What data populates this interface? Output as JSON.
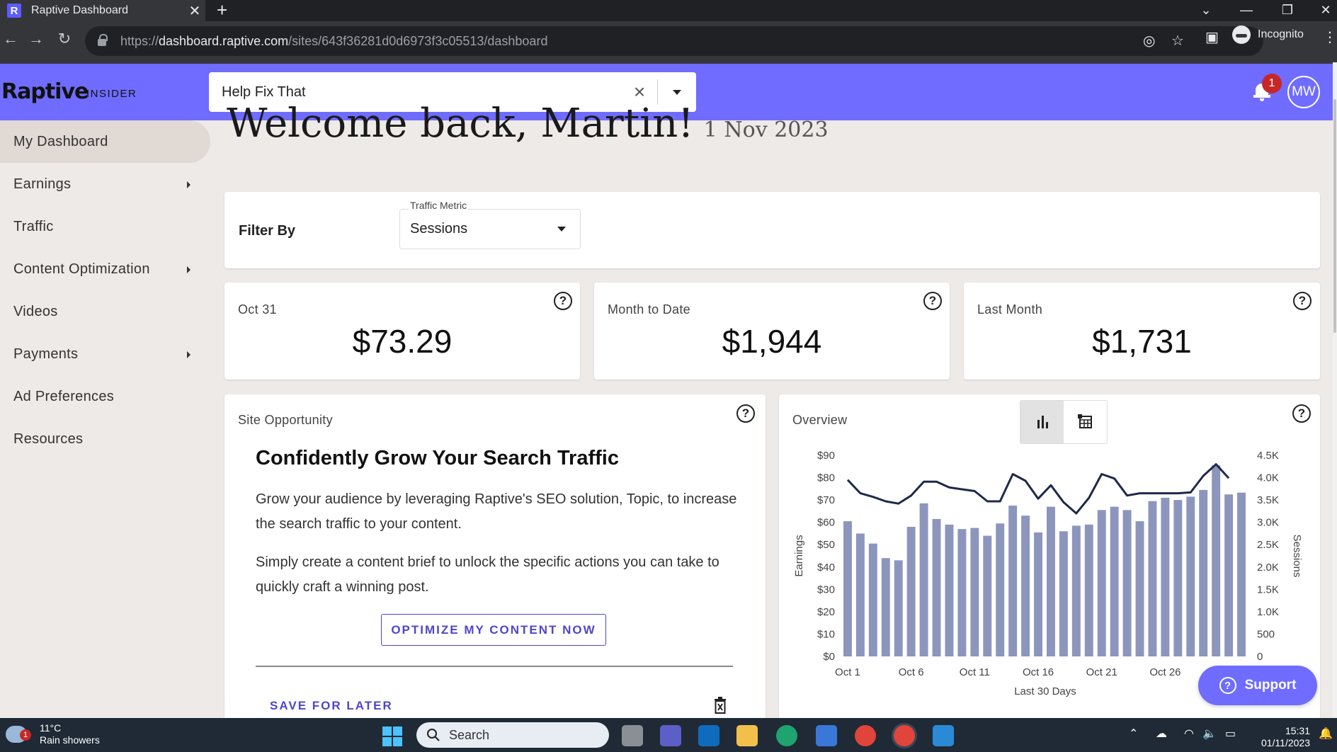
{
  "browser": {
    "tab_title": "Raptive Dashboard",
    "favicon_letter": "R",
    "tab_close": "✕",
    "new_tab": "+",
    "url_prefix": "https://",
    "url_domain": "dashboard.raptive.com",
    "url_path": "/sites/643f36281d0d6973f3c05513/dashboard",
    "profile_label": "Incognito"
  },
  "header": {
    "brand": "Raptive",
    "brand_sub": "INSIDER",
    "site_selector_value": "Help Fix That",
    "notification_count": "1",
    "avatar_initials": "MW"
  },
  "sidebar": {
    "items": [
      {
        "label": "My Dashboard",
        "active": true
      },
      {
        "label": "Earnings",
        "submenu": true
      },
      {
        "label": "Traffic"
      },
      {
        "label": "Content Optimization",
        "submenu": true
      },
      {
        "label": "Videos"
      },
      {
        "label": "Payments",
        "submenu": true
      },
      {
        "label": "Ad Preferences"
      },
      {
        "label": "Resources"
      }
    ]
  },
  "welcome": {
    "greeting": "Welcome back, Martin!",
    "date": "1 Nov 2023"
  },
  "filter": {
    "label": "Filter By",
    "metric_label": "Traffic Metric",
    "metric_value": "Sessions"
  },
  "stats": [
    {
      "label": "Oct 31",
      "value": "$73.29"
    },
    {
      "label": "Month to Date",
      "value": "$1,944"
    },
    {
      "label": "Last Month",
      "value": "$1,731"
    }
  ],
  "opportunity": {
    "title": "Site Opportunity",
    "heading": "Confidently Grow Your Search Traffic",
    "para1": "Grow your audience by leveraging Raptive's SEO solution, Topic, to increase the search traffic to your content.",
    "para2": "Simply create a content brief to unlock the specific actions you can take to quickly craft a winning post.",
    "button": "OPTIMIZE MY CONTENT NOW",
    "save_later": "SAVE FOR LATER"
  },
  "overview": {
    "title": "Overview",
    "views": [
      "chart",
      "table"
    ]
  },
  "support_label": "Support",
  "taskbar": {
    "temp": "11°C",
    "weather": "Rain showers",
    "weather_badge": "1",
    "search_placeholder": "Search",
    "time": "15:31",
    "date": "01/11/2023"
  },
  "colors": {
    "brand": "#6f6cff",
    "accent": "#4f46c8",
    "bar": "#8c96bd",
    "line": "#1e2a4a"
  },
  "chart_data": {
    "type": "bar",
    "xlabel": "Last 30 Days",
    "ylabel": "Earnings",
    "y2label": "Sessions",
    "ylim": [
      0,
      90
    ],
    "y2lim": [
      0,
      4500
    ],
    "yticks": [
      "$0",
      "$10",
      "$20",
      "$30",
      "$40",
      "$50",
      "$60",
      "$70",
      "$80",
      "$90"
    ],
    "y2ticks": [
      "0",
      "500",
      "1.0K",
      "1.5K",
      "2.0K",
      "2.5K",
      "3.0K",
      "3.5K",
      "4.0K",
      "4.5K"
    ],
    "xticks": [
      "Oct 1",
      "Oct 6",
      "Oct 11",
      "Oct 16",
      "Oct 21",
      "Oct 26"
    ],
    "xtick_index": [
      0,
      5,
      10,
      15,
      20,
      25
    ],
    "grid": false,
    "series": [
      {
        "name": "Earnings",
        "kind": "bar",
        "axis": "left",
        "values": [
          60.5,
          55,
          50.5,
          44,
          43,
          58,
          68.5,
          61.5,
          59,
          57,
          57.5,
          54,
          59.5,
          67.5,
          63,
          55.5,
          67,
          56,
          58.5,
          59,
          65.5,
          67,
          65.5,
          60.5,
          69.5,
          71,
          70,
          71.5,
          74.5,
          85.5,
          72.5,
          73.3
        ]
      },
      {
        "name": "Sessions",
        "kind": "line",
        "axis": "right",
        "values": [
          3950,
          3650,
          3570,
          3470,
          3420,
          3600,
          3910,
          3910,
          3780,
          3740,
          3700,
          3470,
          3470,
          4080,
          3930,
          3530,
          3830,
          3450,
          3200,
          3550,
          4080,
          3980,
          3600,
          3650,
          3650,
          3650,
          3650,
          3670,
          4040,
          4300,
          3990
        ]
      }
    ]
  }
}
